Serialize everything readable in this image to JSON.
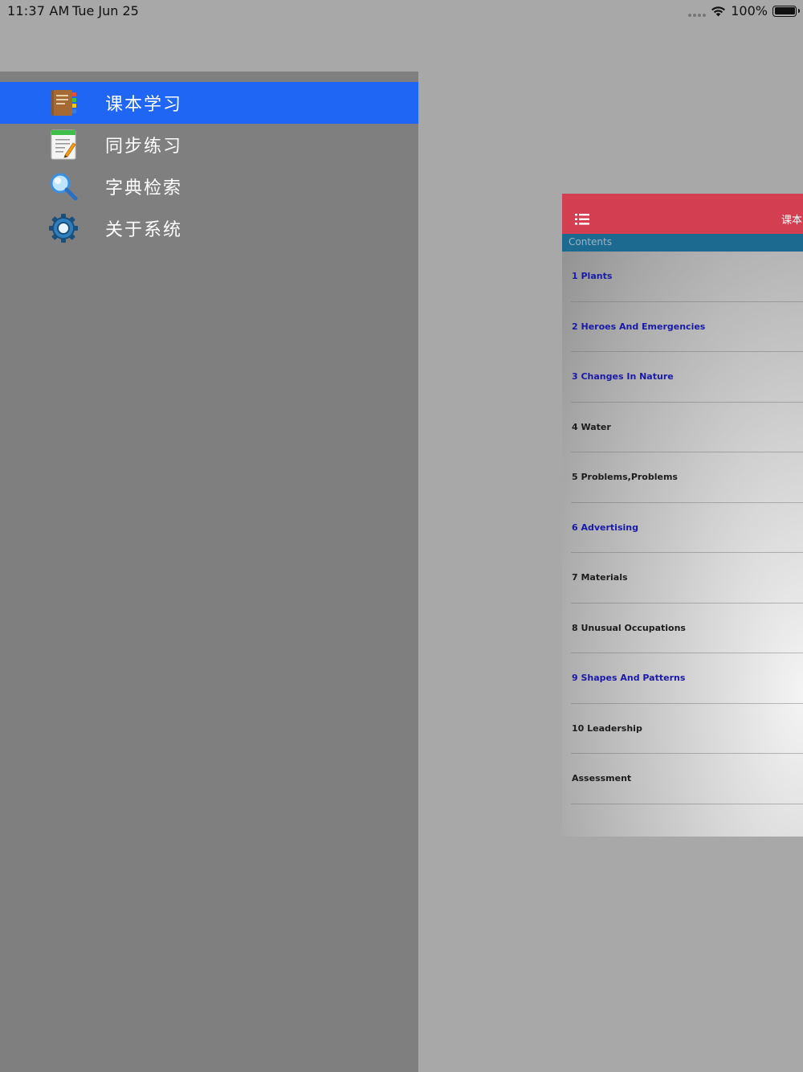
{
  "status_bar": {
    "time": "11:37 AM",
    "date": "Tue Jun 25",
    "battery": "100%"
  },
  "drawer": {
    "items": [
      {
        "label": "课本学习",
        "icon": "textbook-icon",
        "active": true
      },
      {
        "label": "同步练习",
        "icon": "notepad-pencil-icon",
        "active": false
      },
      {
        "label": "字典检索",
        "icon": "magnifier-icon",
        "active": false
      },
      {
        "label": "关于系统",
        "icon": "gear-icon",
        "active": false
      }
    ]
  },
  "preview": {
    "header_title": "课本",
    "contents_label": "Contents",
    "toc": [
      {
        "label": "1 Plants",
        "color": "#1a1aa8"
      },
      {
        "label": "2 Heroes And Emergencies",
        "color": "#1a1aa8"
      },
      {
        "label": "3 Changes In Nature",
        "color": "#1a1aa8"
      },
      {
        "label": "4 Water",
        "color": "#1c1c1c"
      },
      {
        "label": "5 Problems,Problems",
        "color": "#1c1c1c"
      },
      {
        "label": "6 Advertising",
        "color": "#1a1aa8"
      },
      {
        "label": "7 Materials",
        "color": "#1c1c1c"
      },
      {
        "label": "8 Unusual Occupations",
        "color": "#1c1c1c"
      },
      {
        "label": "9 Shapes And Patterns",
        "color": "#1a1aa8"
      },
      {
        "label": "10 Leadership",
        "color": "#1c1c1c"
      },
      {
        "label": "Assessment",
        "color": "#1c1c1c"
      }
    ]
  },
  "colors": {
    "active_item": "#1f66f5",
    "drawer_bg": "#7f7f7f",
    "header_bg": "#d33f50",
    "contents_bar": "#1d6a90"
  }
}
